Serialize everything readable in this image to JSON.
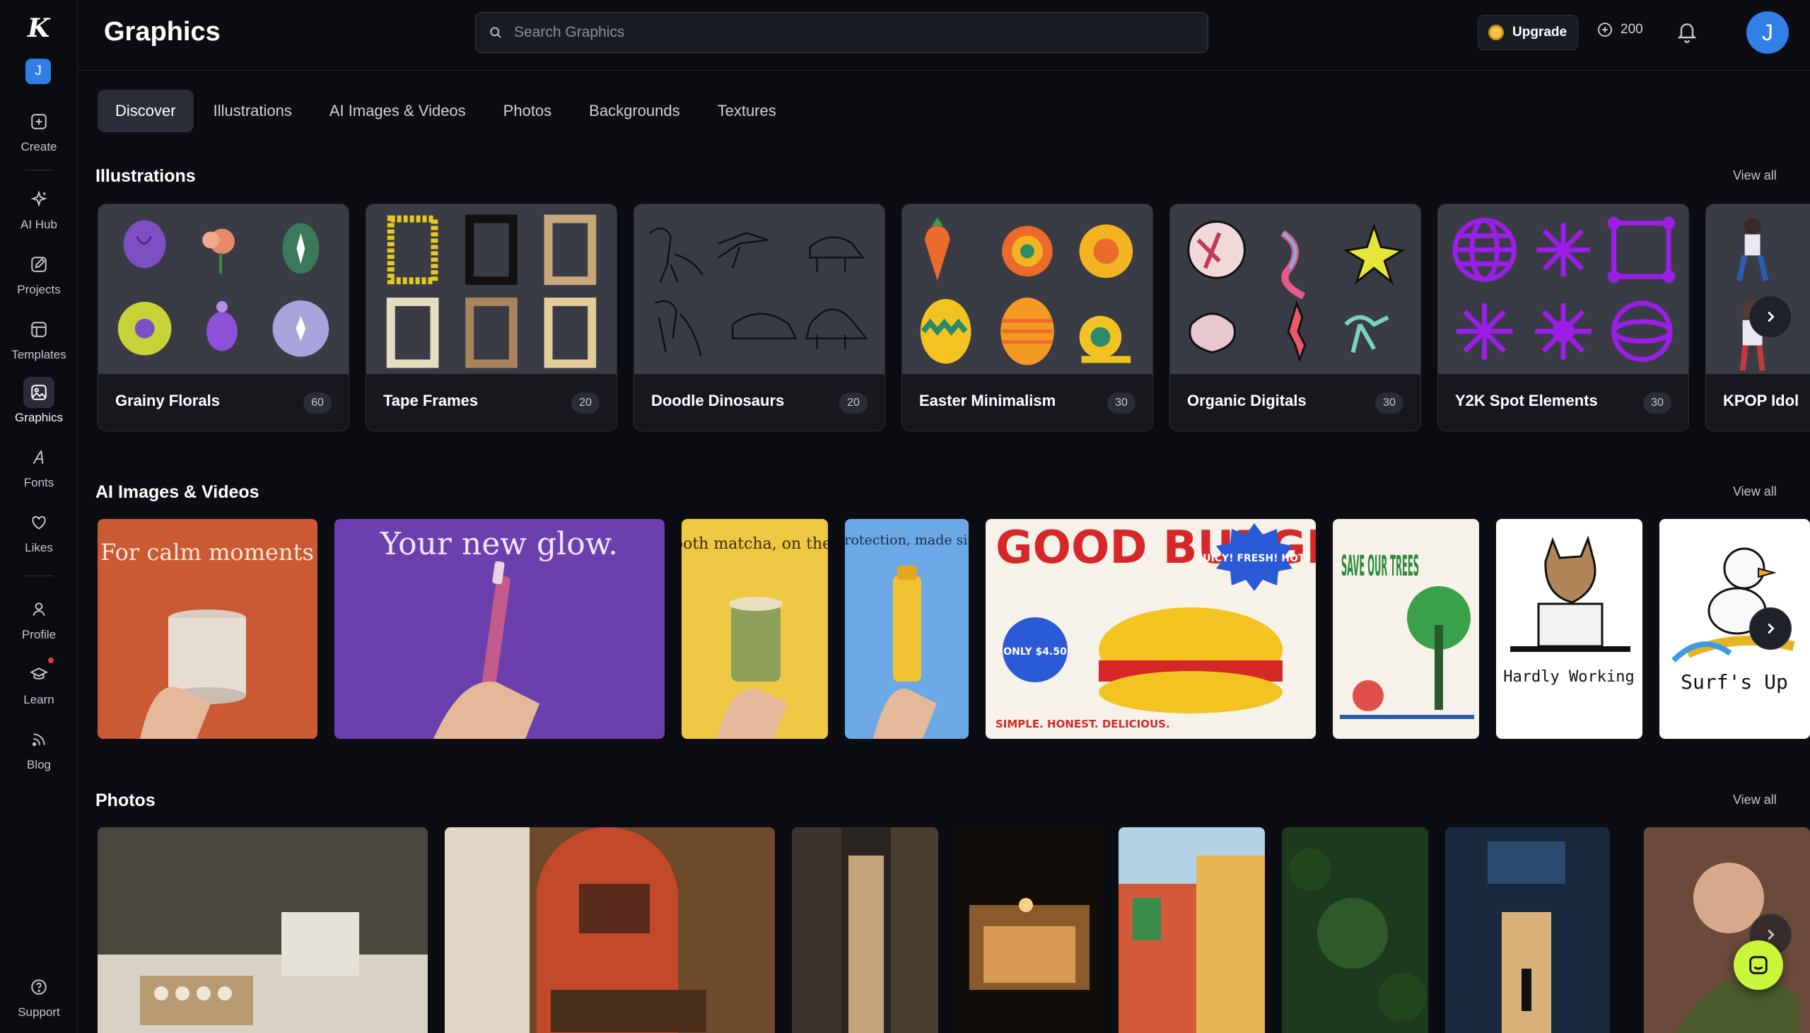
{
  "app": {
    "logo": "K",
    "workspace_initial": "J",
    "page_title": "Graphics"
  },
  "sidebar": {
    "items": [
      {
        "label": "Create",
        "icon": "plus-square-icon"
      },
      {
        "label": "AI Hub",
        "icon": "sparkle-icon"
      },
      {
        "label": "Projects",
        "icon": "edit-square-icon"
      },
      {
        "label": "Templates",
        "icon": "template-icon"
      },
      {
        "label": "Graphics",
        "icon": "image-icon",
        "active": true
      },
      {
        "label": "Fonts",
        "icon": "font-icon"
      },
      {
        "label": "Likes",
        "icon": "heart-icon"
      },
      {
        "label": "Profile",
        "icon": "user-icon"
      },
      {
        "label": "Learn",
        "icon": "graduation-cap-icon"
      },
      {
        "label": "Blog",
        "icon": "rss-icon"
      },
      {
        "label": "Support",
        "icon": "help-circle-icon"
      }
    ]
  },
  "topbar": {
    "search_placeholder": "Search Graphics",
    "upgrade_label": "Upgrade",
    "credits": "200",
    "user_initial": "J"
  },
  "tabs": [
    {
      "label": "Discover",
      "active": true
    },
    {
      "label": "Illustrations"
    },
    {
      "label": "AI Images & Videos"
    },
    {
      "label": "Photos"
    },
    {
      "label": "Backgrounds"
    },
    {
      "label": "Textures"
    }
  ],
  "sections": {
    "illustrations": {
      "title": "Illustrations",
      "view_all": "View all",
      "cards": [
        {
          "title": "Grainy Florals",
          "count": "60"
        },
        {
          "title": "Tape Frames",
          "count": "20"
        },
        {
          "title": "Doodle Dinosaurs",
          "count": "20"
        },
        {
          "title": "Easter Minimalism",
          "count": "30"
        },
        {
          "title": "Organic Digitals",
          "count": "30"
        },
        {
          "title": "Y2K Spot Elements",
          "count": "30"
        },
        {
          "title": "KPOP Idol"
        }
      ]
    },
    "ai": {
      "title": "AI Images & Videos",
      "view_all": "View all",
      "cards": [
        {
          "text": "For calm moments"
        },
        {
          "text": "Your new glow."
        },
        {
          "text": "Smooth matcha, on the go."
        },
        {
          "text": "sun protection, made simple."
        },
        {
          "text": "GOOD BURGER",
          "badge": "JUICY! FRESH! HOT!",
          "price": "ONLY $4.50",
          "tagline": "SIMPLE. HONEST. DELICIOUS."
        },
        {
          "text": "SAVE OUR TREES"
        },
        {
          "text": "Hardly Working"
        },
        {
          "text": "Surf's Up"
        }
      ]
    },
    "photos": {
      "title": "Photos",
      "view_all": "View all"
    }
  },
  "colors": {
    "background": "#0c0d12",
    "accent_blue": "#2f7fe6",
    "chat_green": "#c9f53a",
    "purple": "#9a1ee6"
  }
}
